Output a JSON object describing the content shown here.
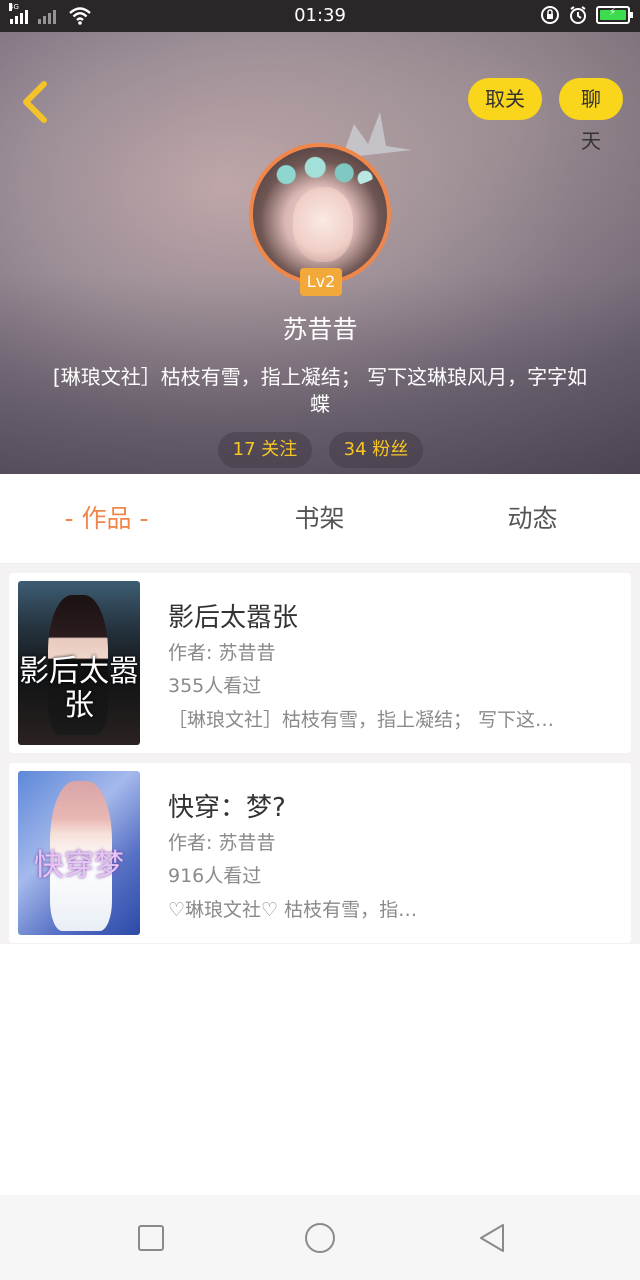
{
  "status_bar": {
    "time": "01:39",
    "net_label": "4G",
    "battery_color": "#3ddc4f"
  },
  "header": {
    "back_icon": "chevron-left-icon",
    "unfollow_label": "取关",
    "chat_label": "聊天",
    "level": "Lv2",
    "username": "苏昔昔",
    "bio": "[琳琅文社］枯枝有雪，指上凝结； 写下这琳琅风月，字字如蝶",
    "follow_stat": "17 关注",
    "fans_stat": "34 粉丝",
    "accent_yellow": "#f9d51c",
    "avatar_ring_color": "#f0874a"
  },
  "tabs": [
    {
      "label": "- 作品 -",
      "active": true
    },
    {
      "label": "书架",
      "active": false
    },
    {
      "label": "动态",
      "active": false
    }
  ],
  "works": [
    {
      "cover_text": "影后太嚣张",
      "title": "影后太嚣张",
      "author": "作者: 苏昔昔",
      "views": "355人看过",
      "desc": "［琳琅文社］枯枝有雪，指上凝结； 写下这…"
    },
    {
      "cover_text": "快穿梦",
      "title": "快穿：梦?",
      "author": "作者: 苏昔昔",
      "views": "916人看过",
      "desc": "♡琳琅文社♡ 枯枝有雪，指…"
    }
  ],
  "nav_bar": {
    "recents_icon": "square-icon",
    "home_icon": "circle-icon",
    "back_icon": "triangle-back-icon"
  }
}
